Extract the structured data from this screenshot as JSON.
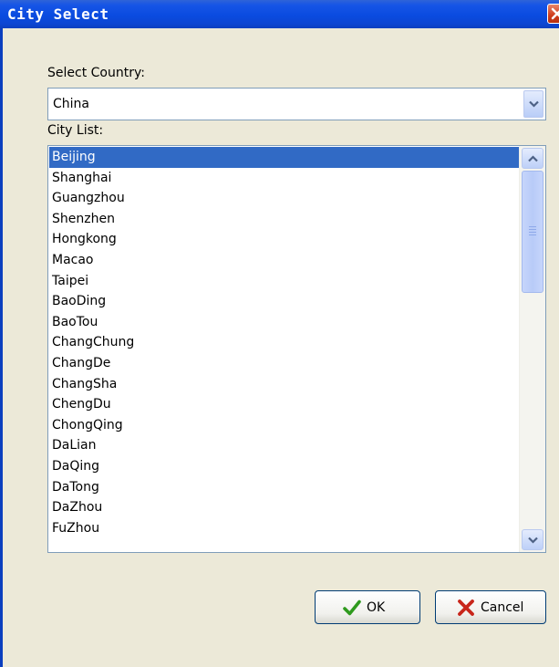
{
  "window": {
    "title": "City Select"
  },
  "country": {
    "label": "Select Country:",
    "selected": "China"
  },
  "cities": {
    "label": "City List:",
    "selected_index": 0,
    "items": [
      "Beijing",
      "Shanghai",
      "Guangzhou",
      "Shenzhen",
      "Hongkong",
      "Macao",
      "Taipei",
      "BaoDing",
      "BaoTou",
      "ChangChung",
      "ChangDe",
      "ChangSha",
      "ChengDu",
      "ChongQing",
      "DaLian",
      "DaQing",
      "DaTong",
      "DaZhou",
      "FuZhou"
    ]
  },
  "buttons": {
    "ok": "OK",
    "cancel": "Cancel"
  },
  "icons": {
    "close": "close-icon",
    "ok": "checkmark-icon",
    "cancel": "x-mark-icon",
    "dropdown": "chevron-down-icon",
    "scroll_up": "chevron-up-icon",
    "scroll_down": "chevron-down-icon"
  },
  "colors": {
    "titlebar": "#0a4be0",
    "selection": "#316ac5",
    "dialog_bg": "#ece9d8",
    "ok_check": "#2f9a1e",
    "cancel_x": "#c8261b"
  }
}
